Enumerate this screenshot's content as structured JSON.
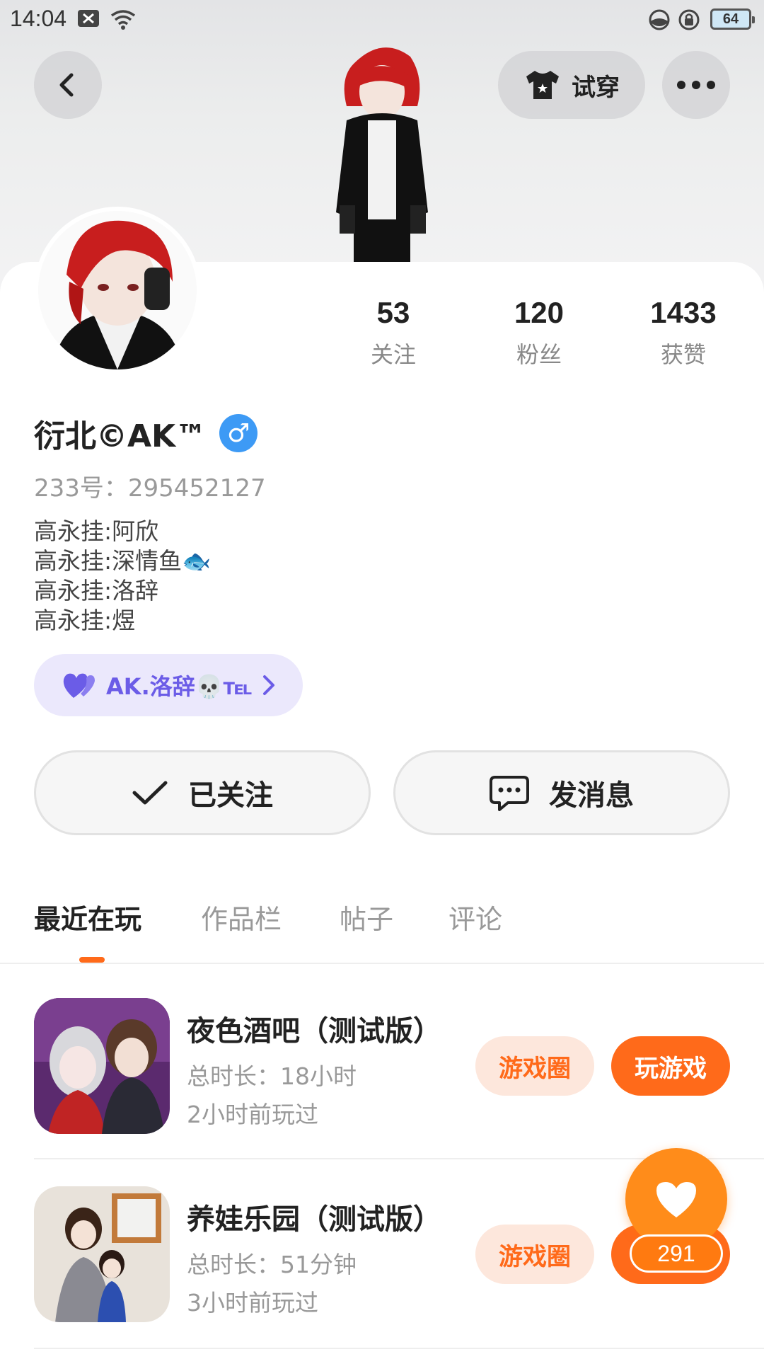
{
  "status_bar": {
    "time": "14:04",
    "battery": "64"
  },
  "header": {
    "try_on_label": "试穿"
  },
  "profile": {
    "stats": [
      {
        "value": "53",
        "label": "关注"
      },
      {
        "value": "120",
        "label": "粉丝"
      },
      {
        "value": "1433",
        "label": "获赞"
      }
    ],
    "name": "衍北©AK™",
    "gender_symbol": "♂",
    "uid": "233号：295452127",
    "bio": [
      "高永挂:阿欣",
      "高永挂:深情鱼🐟",
      "高永挂:洛辞",
      "高永挂:煜"
    ],
    "cp_tag": "AK.洛辞💀℡"
  },
  "actions": {
    "following_label": "已关注",
    "message_label": "发消息"
  },
  "tabs": [
    "最近在玩",
    "作品栏",
    "帖子",
    "评论"
  ],
  "games": [
    {
      "title": "夜色酒吧（测试版）",
      "duration": "总时长：18小时",
      "last_played": "2小时前玩过",
      "circle_label": "游戏圈",
      "play_label": "玩游戏"
    },
    {
      "title": "养娃乐园（测试版）",
      "duration": "总时长：51分钟",
      "last_played": "3小时前玩过",
      "circle_label": "游戏圈"
    }
  ],
  "like_fab": {
    "count": "291"
  },
  "colors": {
    "accent": "#ff6a1a",
    "cp_purple": "#6b5ce7",
    "gender_blue": "#3d9af5"
  }
}
